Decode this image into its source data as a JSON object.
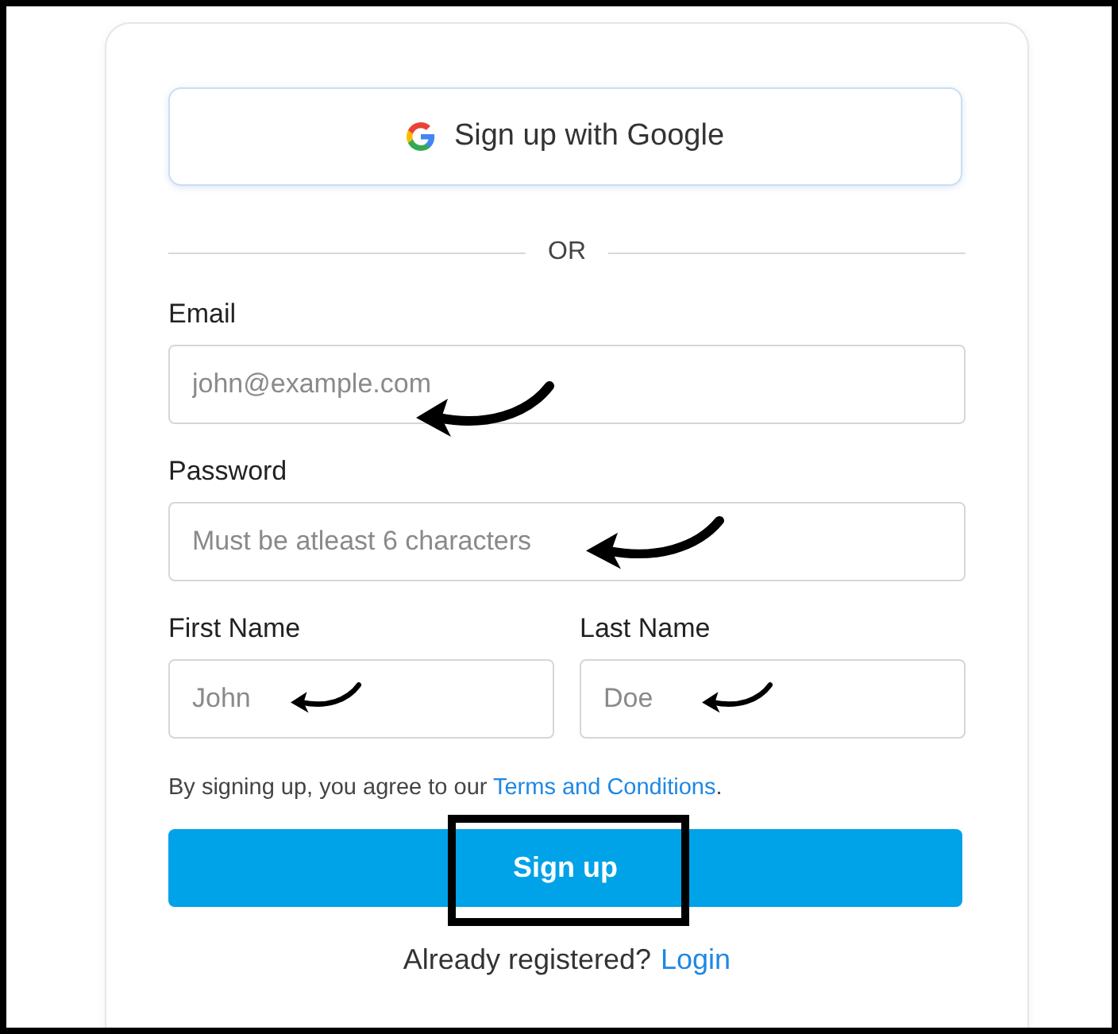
{
  "google_button": {
    "label": "Sign up with Google"
  },
  "divider": {
    "label": "OR"
  },
  "fields": [
    {
      "label": "Email",
      "placeholder": "john@example.com",
      "annotated": true
    },
    {
      "label": "Password",
      "placeholder": "Must be atleast 6 characters",
      "annotated": true
    }
  ],
  "name_fields": [
    {
      "label": "First Name",
      "placeholder": "John",
      "annotated": true
    },
    {
      "label": "Last Name",
      "placeholder": "Doe",
      "annotated": true
    }
  ],
  "terms": {
    "text": "By signing up, you agree to our ",
    "link": "Terms and Conditions",
    "end": "."
  },
  "submit": {
    "label": "Sign up",
    "highlighted": true
  },
  "login": {
    "text": "Already registered?",
    "link": "Login"
  }
}
